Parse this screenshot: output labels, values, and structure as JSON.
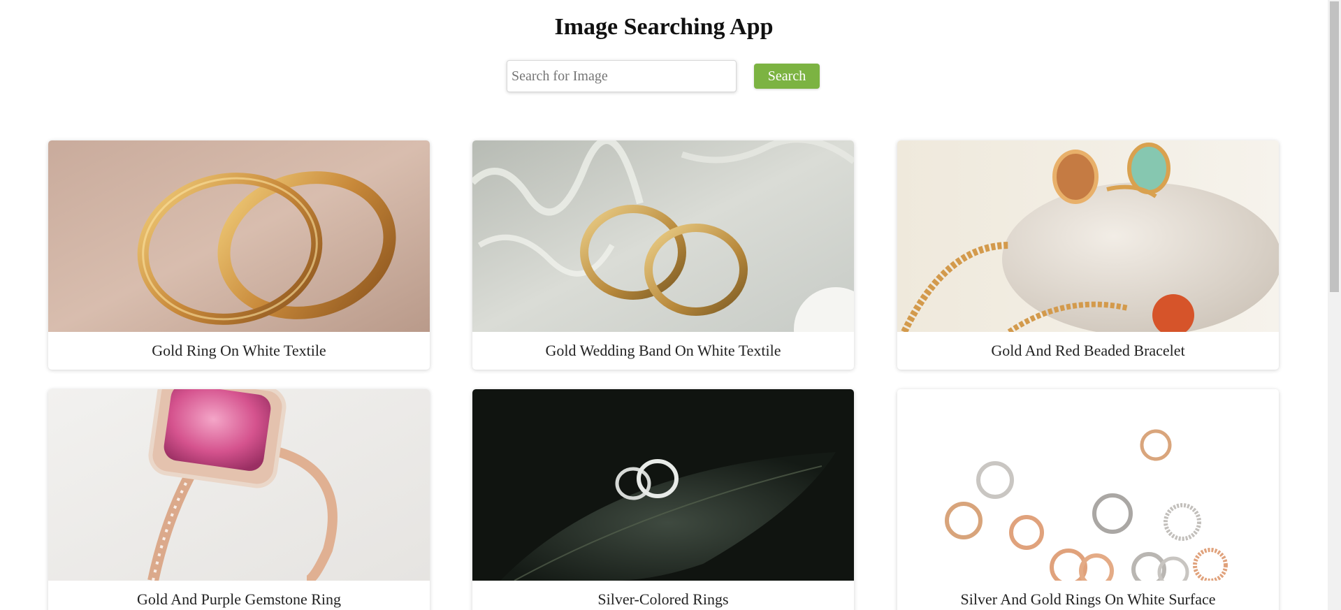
{
  "app": {
    "title": "Image Searching App"
  },
  "search": {
    "placeholder": "Search for Image",
    "value": "",
    "button_label": "Search",
    "button_color": "#7cb342"
  },
  "results": [
    {
      "caption": "Gold Ring On White Textile"
    },
    {
      "caption": "Gold Wedding Band On White Textile"
    },
    {
      "caption": "Gold And Red Beaded Bracelet"
    },
    {
      "caption": "Gold And Purple Gemstone Ring"
    },
    {
      "caption": "Silver-Colored Rings"
    },
    {
      "caption": "Silver And Gold Rings On White Surface"
    }
  ]
}
